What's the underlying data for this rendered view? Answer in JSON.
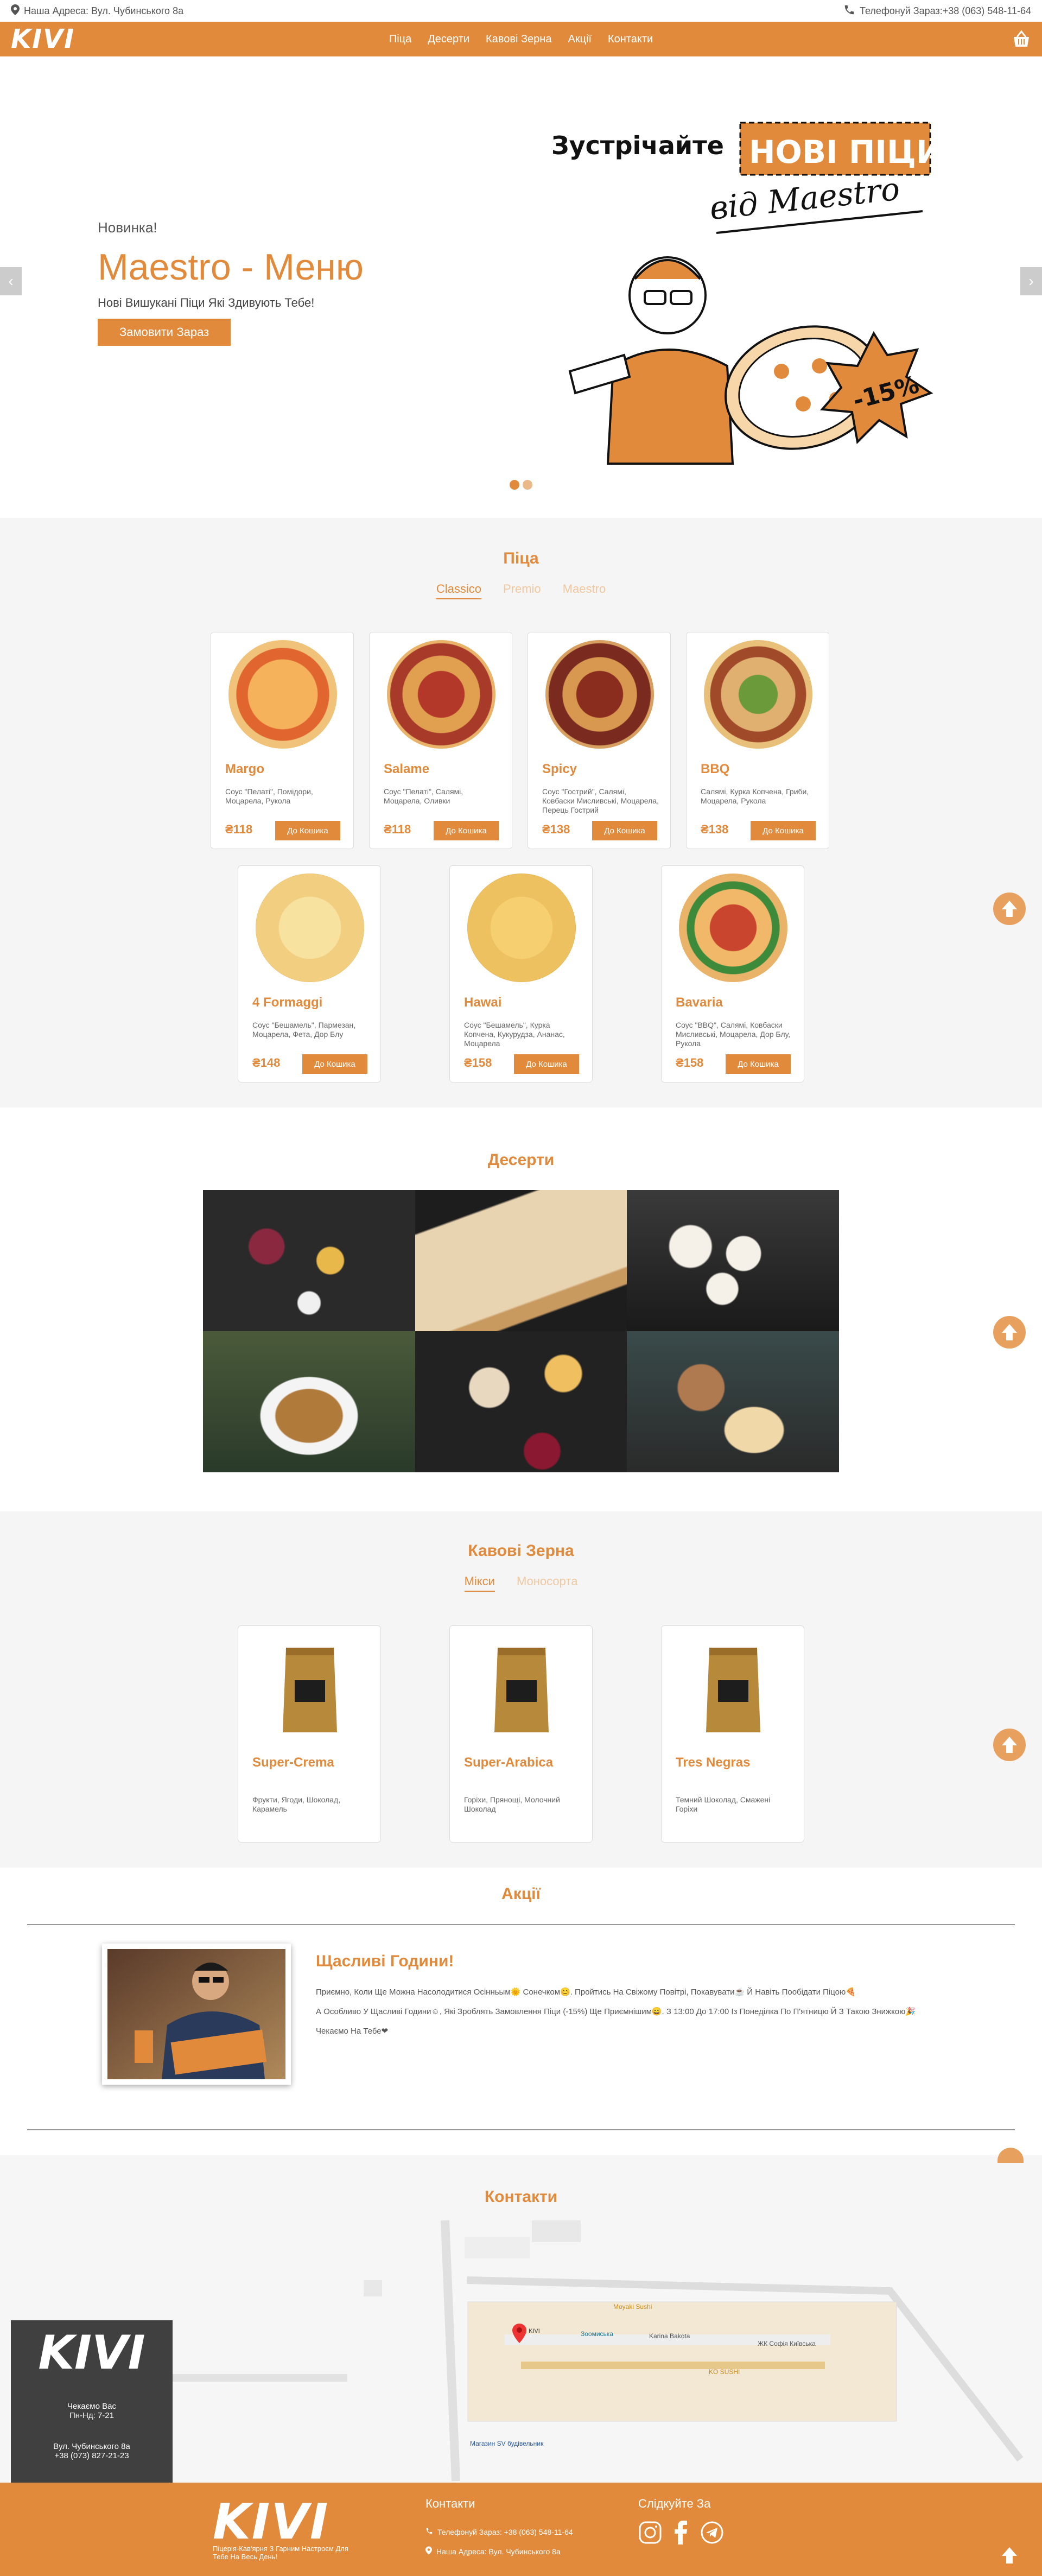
{
  "topbar": {
    "address": "Наша Адреса: Вул. Чубинського 8а",
    "phone": "Телефонуй Зараз:+38 (063) 548-11-64"
  },
  "brand": {
    "logo": "KIVI"
  },
  "nav": {
    "items": [
      "Піца",
      "Десерти",
      "Кавові Зерна",
      "Акції",
      "Контакти"
    ]
  },
  "hero": {
    "kicker": "Новинка!",
    "title": "Maestro - Меню",
    "subtitle": "Нові Вишукані Піци Які Здивують Тебе!",
    "button": "Замовити Зараз",
    "art_line1": "Зустрічайте",
    "art_badge": "НОВІ ПІЦИ",
    "art_line2": "від Maestro",
    "art_discount": "-15%",
    "prev": "‹",
    "next": "›"
  },
  "pizza": {
    "title": "Піца",
    "tabs": [
      "Classico",
      "Premio",
      "Maestro"
    ],
    "active_tab": "Classico",
    "add_label": "До Кошика",
    "currency": "₴",
    "items": [
      {
        "name": "Margo",
        "desc": "Соус \"Пелаті\", Помідори, Моцарела, Рукола",
        "price": "118"
      },
      {
        "name": "Salame",
        "desc": "Соус \"Пелаті\", Салямі, Моцарела, Оливки",
        "price": "118"
      },
      {
        "name": "Spicy",
        "desc": "Соус \"Гострий\", Салямі, Ковбаски Мисливські, Моцарела, Перець Гострий",
        "price": "138"
      },
      {
        "name": "BBQ",
        "desc": "Салямі, Курка Копчена, Гриби, Моцарела, Рукола",
        "price": "138"
      },
      {
        "name": "4 Formaggi",
        "desc": "Соус \"Бешамель\", Пармезан, Моцарела, Фета, Дор Блу",
        "price": "148"
      },
      {
        "name": "Hawai",
        "desc": "Соус \"Бешамель\", Курка Копчена, Кукурудза, Ананас, Моцарела",
        "price": "158"
      },
      {
        "name": "Bavaria",
        "desc": "Соус \"BBQ\", Салямі, Ковбаски Мисливські, Моцарела, Дор Блу, Рукола",
        "price": "158"
      }
    ]
  },
  "desserts": {
    "title": "Десерти"
  },
  "coffee": {
    "title": "Кавові Зерна",
    "tabs": [
      "Мікси",
      "Моносорта"
    ],
    "active_tab": "Мікси",
    "items": [
      {
        "name": "Super-Crema",
        "desc": "Фрукти, Ягоди, Шоколад, Карамель"
      },
      {
        "name": "Super-Arabica",
        "desc": "Горіхи, Прянощі, Молочний Шоколад"
      },
      {
        "name": "Tres Negras",
        "desc": "Темний Шоколад, Смажені Горіхи"
      }
    ]
  },
  "promo": {
    "title": "Акції",
    "card_title": "Щасливі Години!",
    "line1": "Приємно, Коли Ще Можна Насолодитися Осінньым🌞 Сонечком😊. Пройтись На Свіжому Повітрі, Покавувати☕ Й Навіть Пообідати Піцою🍕",
    "line2": "А Особливо У Щасливі Години☺, Які Зроблять Замовлення Піци (-15%) Ще Приємнішим😀. З 13:00 До 17:00 Із Понеділка По П'ятницю Й З Такою Знижкою🎉",
    "line3": "Чекаємо На Тебе❤"
  },
  "contacts": {
    "title": "Контакти",
    "box_logo": "KIVI",
    "box_hours_title": "Чекаємо Вас",
    "box_hours": "Пн-Нд: 7-21",
    "box_address": "Вул. Чубинського 8а",
    "box_phone": "+38 (073) 827-21-23",
    "map_labels": [
      "Moyaki Sushi",
      "Зоомиська",
      "Karina Bakota",
      "ЖК Софія Київська",
      "KO SUSHI",
      "KIVI",
      "Магазин SV будівельник"
    ]
  },
  "footer": {
    "logo": "KIVI",
    "tagline": "Піцерія-Кав'ярня З Гарним Настроєм Для Тебе На Весь День!",
    "contacts_title": "Контакти",
    "phone": "Телефонуй Зараз: +38 (063) 548-11-64",
    "address": "Наша Адреса: Вул. Чубинського 8а",
    "follow_title": "Слідкуйте За"
  },
  "colors": {
    "accent": "#e18a3c"
  }
}
